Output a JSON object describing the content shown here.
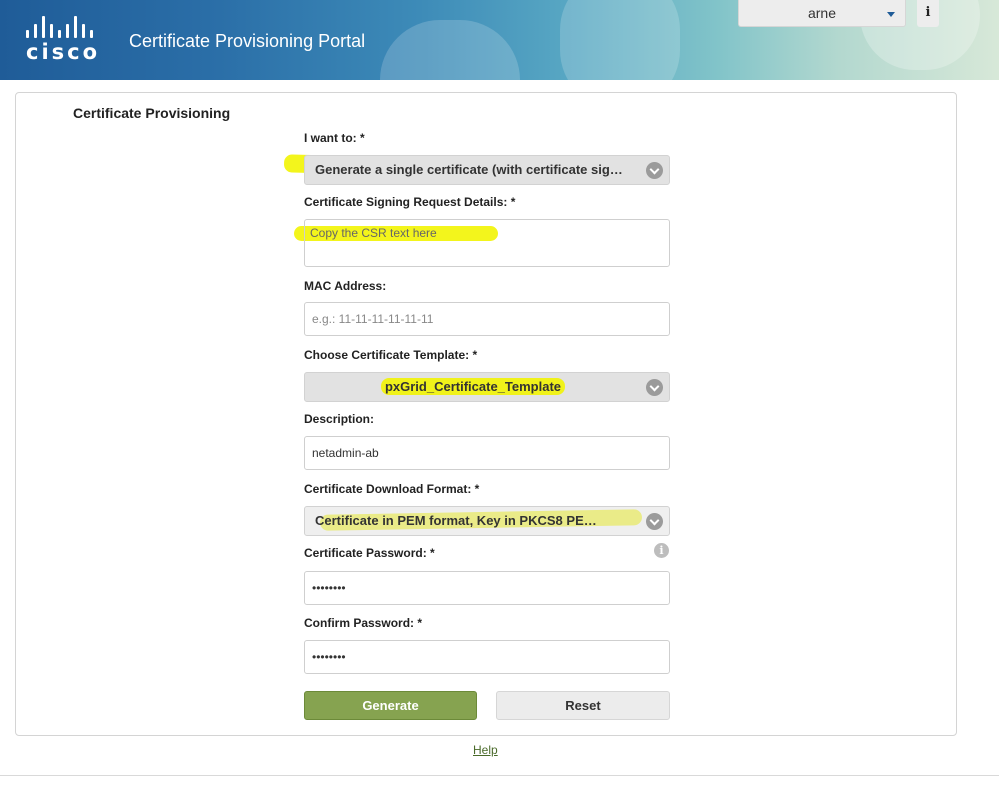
{
  "header": {
    "logo_text": "cisco",
    "portal_title": "Certificate Provisioning Portal",
    "user": "arne",
    "info_icon": "info-icon",
    "colors": {
      "banner_start": "#1f5c98",
      "banner_end": "#d7e8d8"
    }
  },
  "panel": {
    "title": "Certificate Provisioning"
  },
  "form": {
    "i_want_to": {
      "label": "I want to: *",
      "value": "Generate a single certificate (with certificate sig…"
    },
    "csr": {
      "label": "Certificate Signing Request Details: *",
      "placeholder": "Copy the CSR text here"
    },
    "mac": {
      "label": "MAC Address:",
      "placeholder": "e.g.: 11-11-11-11-11-11"
    },
    "template": {
      "label": "Choose Certificate Template: *",
      "value": "pxGrid_Certificate_Template"
    },
    "description": {
      "label": "Description:",
      "value": "netadmin-ab"
    },
    "download_format": {
      "label": "Certificate Download Format: *",
      "value": "Certificate in PEM format, Key in PKCS8 PE…"
    },
    "password": {
      "label": "Certificate Password: *",
      "value": "••••••••",
      "info_icon": "info-icon"
    },
    "confirm_password": {
      "label": "Confirm Password: *",
      "value": "••••••••"
    },
    "buttons": {
      "generate": "Generate",
      "reset": "Reset"
    },
    "highlight_color": "#f3f51c"
  },
  "footer": {
    "help": "Help"
  }
}
